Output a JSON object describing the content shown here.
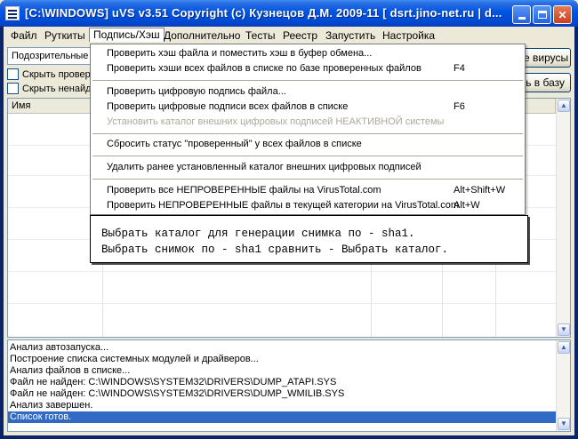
{
  "window": {
    "title": "[C:\\WINDOWS] uVS v3.51 Copyright (c) Кузнецов Д.М. 2009-11 [ dsrt.jino-net.ru | d..."
  },
  "menubar": {
    "items": [
      "Файл",
      "Руткиты",
      "Подпись/Хэш",
      "Дополнительно",
      "Тесты",
      "Реестр",
      "Запустить",
      "Настройка"
    ]
  },
  "toolbar": {
    "combo_value": "Подозрительные",
    "checkbox1_label": "Скрыть провер",
    "checkbox2_label": "Скрыть ненайд",
    "button1_label": "е вирусы",
    "button2_label": "ь в базу"
  },
  "list": {
    "column_name": "Имя"
  },
  "dropdown": {
    "items": [
      {
        "label": "Проверить хэш файла и поместить хэш в буфер обмена...",
        "shortcut": ""
      },
      {
        "label": "Проверить хэши всех файлов в списке по базе проверенных файлов",
        "shortcut": "F4"
      },
      {
        "label": "Проверить цифровую подпись файла...",
        "shortcut": ""
      },
      {
        "label": "Проверить цифровые подписи всех файлов в списке",
        "shortcut": "F6"
      },
      {
        "label": "Установить каталог внешних цифровых подписей НЕАКТИВНОЙ системы",
        "shortcut": ""
      },
      {
        "label": "Сбросить статус \"проверенный\" у всех файлов в списке",
        "shortcut": ""
      },
      {
        "label": "Удалить ранее установленный каталог внешних цифровых подписей",
        "shortcut": ""
      },
      {
        "label": "Проверить все НЕПРОВЕРЕННЫЕ файлы на VirusTotal.com",
        "shortcut": "Alt+Shift+W"
      },
      {
        "label": "Проверить НЕПРОВЕРЕННЫЕ файлы в текущей категории на VirusTotal.com",
        "shortcut": "Alt+W"
      }
    ]
  },
  "tooltip": {
    "line1": "Выбрать каталог для генерации снимка по - sha1.",
    "line2": "Выбрать снимок по - sha1 сравнить - Выбрать каталог."
  },
  "log": {
    "lines": [
      "Анализ автозапуска...",
      "Построение списка системных модулей и драйверов...",
      "Анализ файлов в списке...",
      "Файл не найден: C:\\WINDOWS\\SYSTEM32\\DRIVERS\\DUMP_ATAPI.SYS",
      "Файл не найден: C:\\WINDOWS\\SYSTEM32\\DRIVERS\\DUMP_WMILIB.SYS",
      "Анализ завершен.",
      "Список готов."
    ]
  },
  "colors": {
    "titlebar": "#0054e3",
    "selection": "#316ac5",
    "close_button": "#c9401c",
    "disabled_text": "#aca899"
  }
}
